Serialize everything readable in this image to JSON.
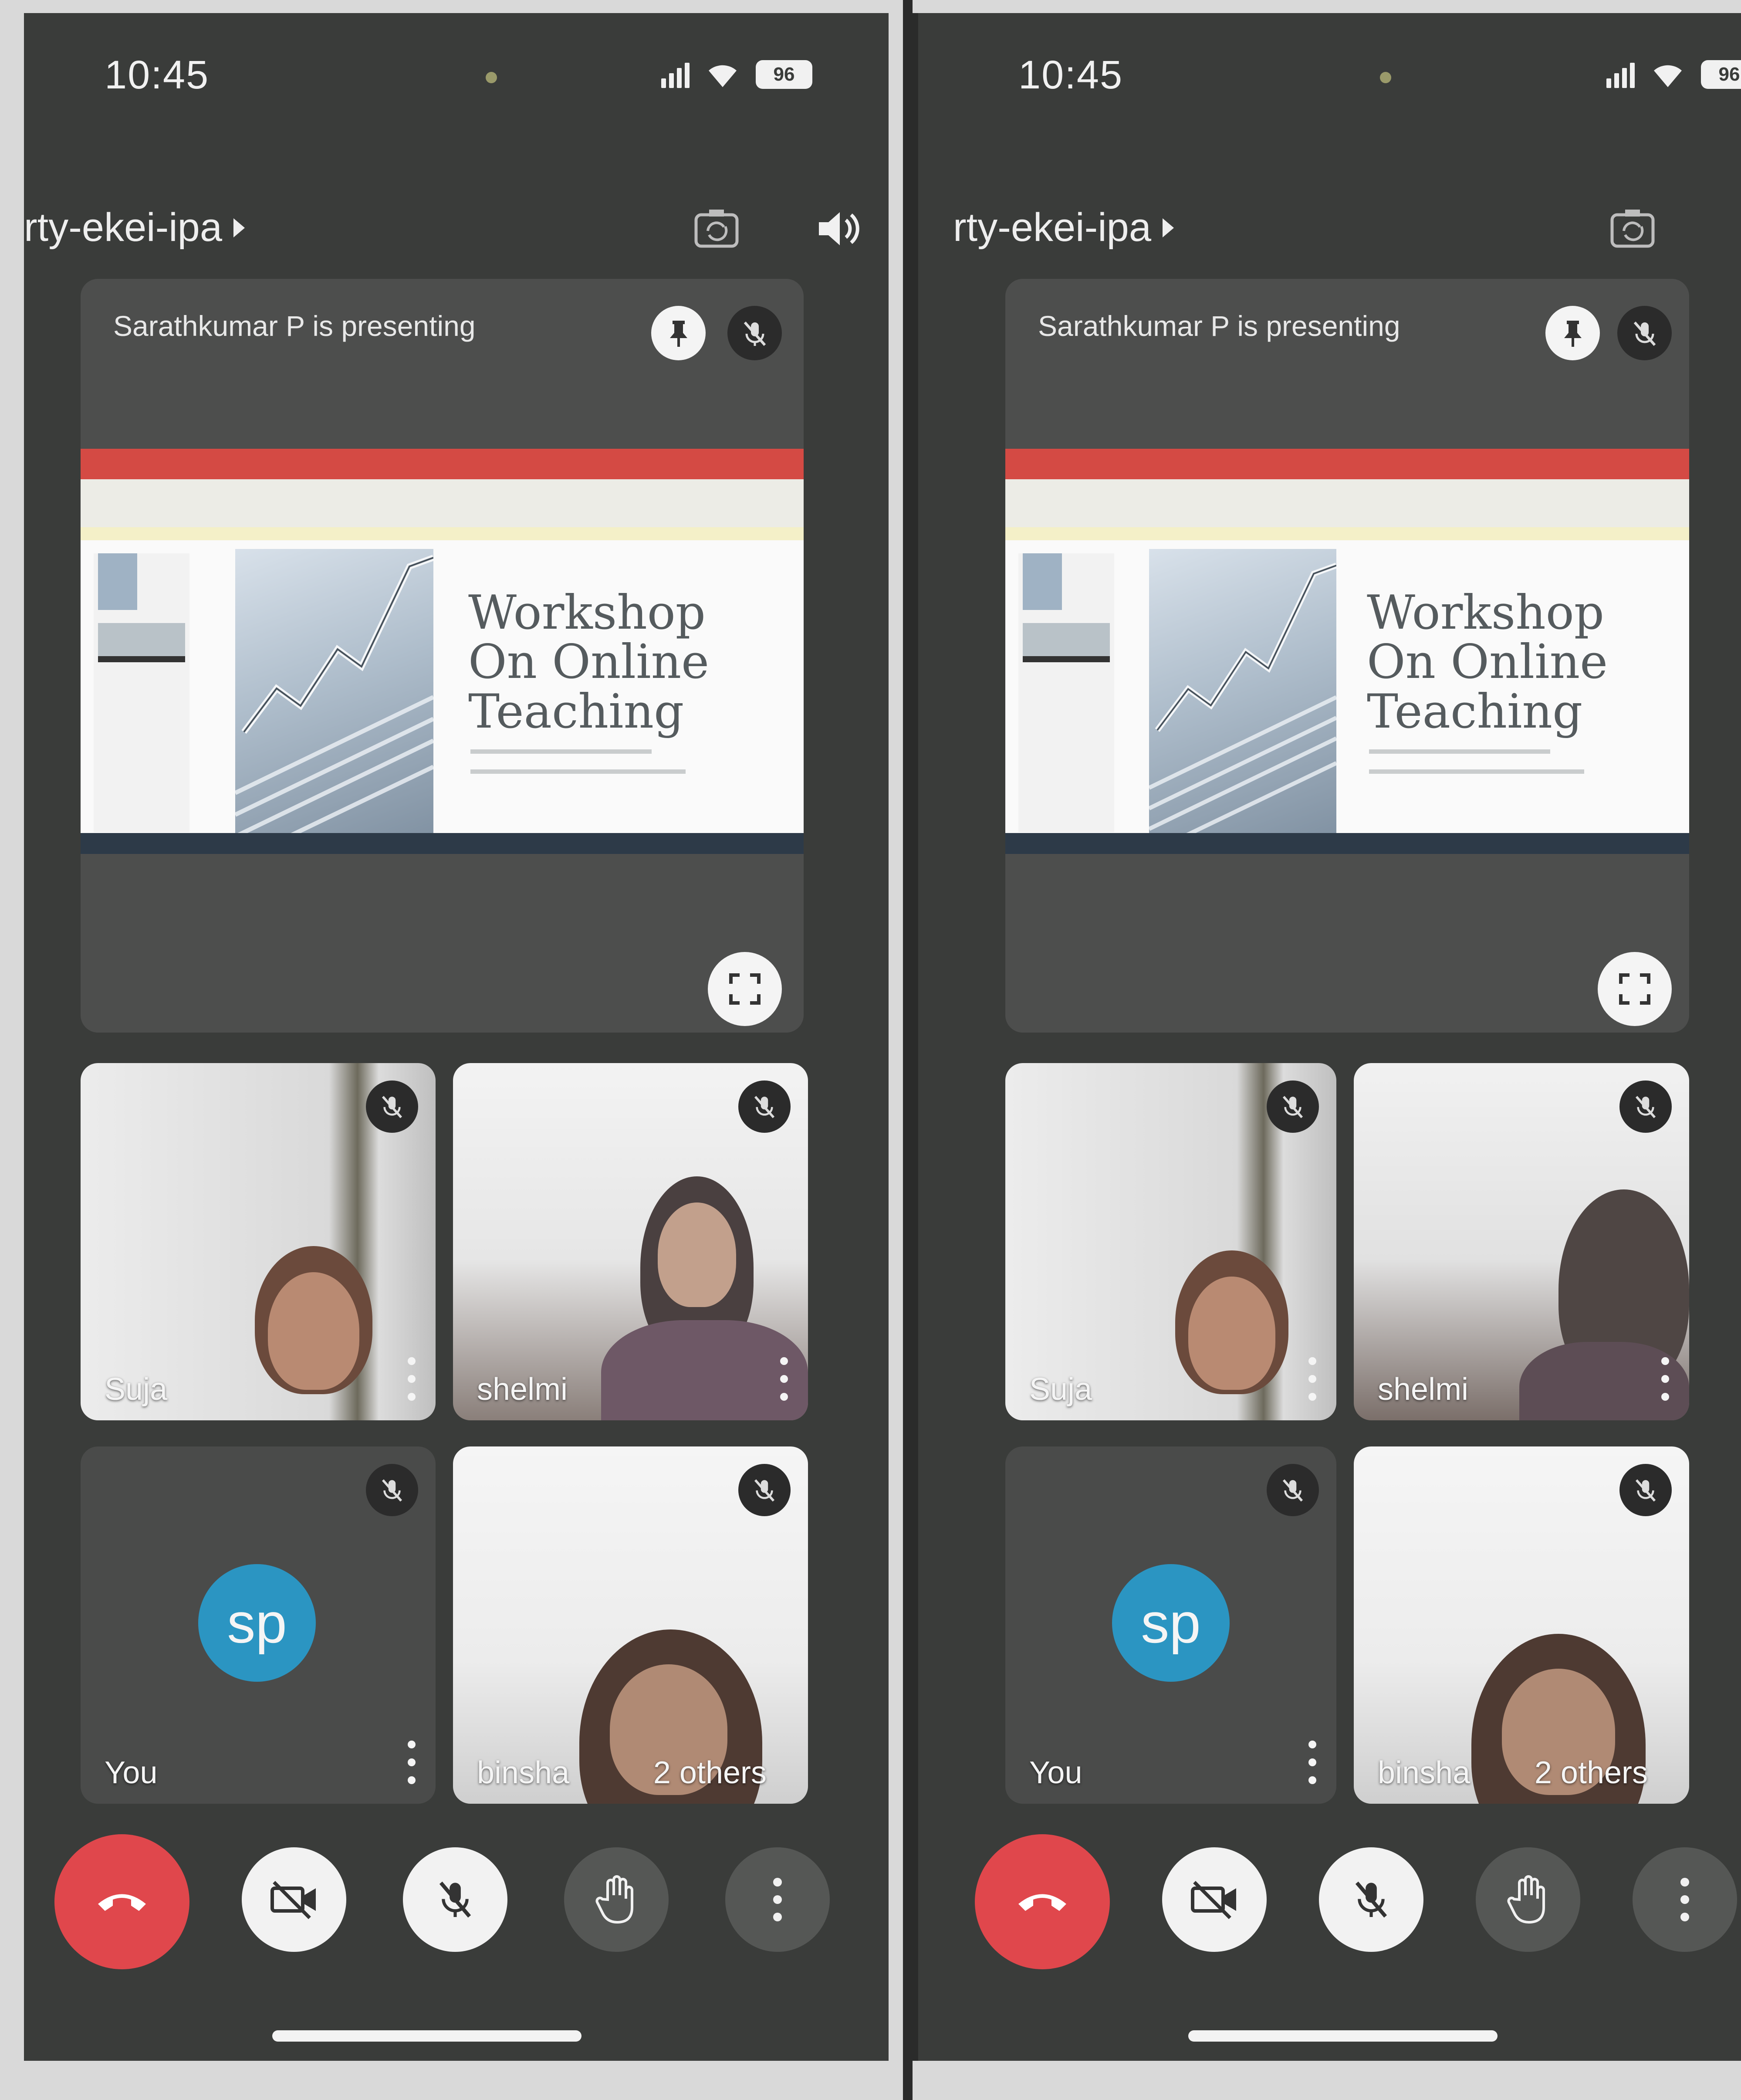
{
  "screens": [
    {
      "status_bar": {
        "time": "10:45",
        "battery": "96"
      },
      "meeting": {
        "code": "rty-ekei-ipa"
      },
      "presentation": {
        "title": "Sarathkumar P is presenting",
        "slide_title_lines": [
          "Workshop",
          "On Online",
          "Teaching"
        ]
      },
      "participants": [
        {
          "name": "Suja"
        },
        {
          "name": "shelmi"
        },
        {
          "name": "You",
          "avatar": "sp"
        },
        {
          "name": "binsha",
          "extra": "2 others"
        }
      ]
    },
    {
      "status_bar": {
        "time": "10:45",
        "battery": "96"
      },
      "meeting": {
        "code": "rty-ekei-ipa"
      },
      "presentation": {
        "title": "Sarathkumar P is presenting",
        "slide_title_lines": [
          "Workshop",
          "On Online",
          "Teaching"
        ]
      },
      "participants": [
        {
          "name": "Suja"
        },
        {
          "name": "shelmi"
        },
        {
          "name": "You",
          "avatar": "sp"
        },
        {
          "name": "binsha",
          "extra": "2 others"
        }
      ]
    }
  ],
  "icons": {
    "header": [
      "switch-camera-icon",
      "speaker-icon"
    ],
    "presentation": [
      "pin-icon",
      "mic-off-icon",
      "fullscreen-icon"
    ],
    "controls": [
      "end-call-icon",
      "camera-off-icon",
      "mic-off-icon",
      "raise-hand-icon",
      "more-options-icon"
    ]
  },
  "colors": {
    "background": "#3a3c3a",
    "end_call": "#e0474c",
    "avatar": "#2b95c2",
    "slide_ribbon": "#d44a44"
  }
}
